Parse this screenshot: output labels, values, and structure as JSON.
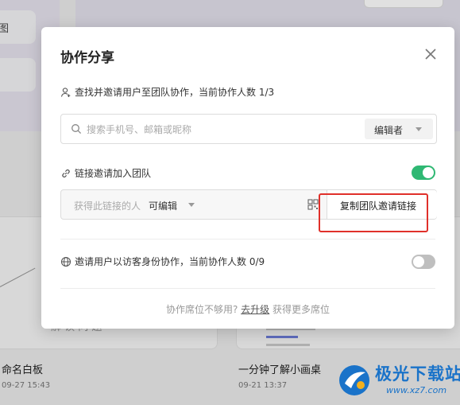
{
  "background": {
    "side_items": [
      "图",
      ""
    ],
    "cards": [
      {
        "title": "命名白板",
        "date": "09-27 15:43"
      },
      {
        "title": "一分钟了解小画桌",
        "date": "09-21 13:37"
      }
    ],
    "card_note": "解 读 问 题"
  },
  "modal": {
    "title": "协作分享",
    "search_section_label": "查找并邀请用户至团队协作，当前协作人数 1/3",
    "search_placeholder": "搜索手机号、邮箱或昵称",
    "role_select_value": "编辑者",
    "link_section_label": "链接邀请加入团队",
    "link_toggle_on": true,
    "link_permission_prefix": "获得此链接的人",
    "link_permission_value": "可编辑",
    "copy_link_button": "复制团队邀请链接",
    "guest_section_label": "邀请用户以访客身份协作，当前协作人数 0/9",
    "guest_toggle_on": false,
    "footer_prefix": "协作席位不够用?",
    "footer_link": "去升级",
    "footer_suffix": "获得更多席位"
  },
  "watermark": {
    "text": "极光下载站",
    "url": "www.xz7.com"
  },
  "colors": {
    "toggle_on": "#2fb873",
    "toggle_off": "#bfbfbf",
    "annotation": "#e0302a",
    "watermark": "#1a73c9"
  }
}
